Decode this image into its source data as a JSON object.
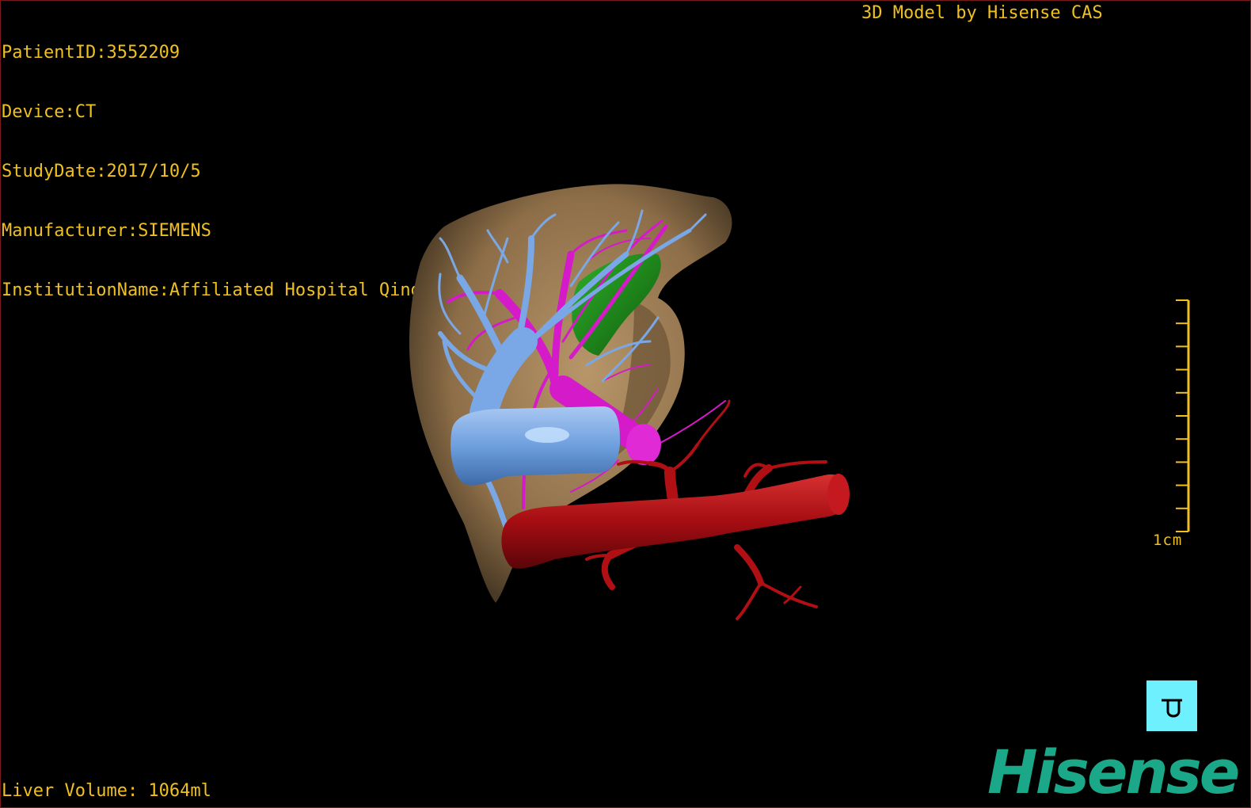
{
  "patient_info": {
    "patient_id": "PatientID:3552209",
    "device": "Device:CT",
    "study_date": "StudyDate:2017/10/5",
    "manufacturer": "Manufacturer:SIEMENS",
    "institution": "InstitutionName:Affiliated Hospital Qingdao University-C"
  },
  "credit": "3D Model by Hisense CAS",
  "liver_volume": "Liver Volume: 1064ml",
  "scale_bar": {
    "label": "1cm",
    "tick_count": 10
  },
  "orientation_button": {
    "icon": "orientation-cube-icon"
  },
  "brand": "Hisense",
  "colors": {
    "overlay_text": "#f0c020",
    "liver": "#a8865a",
    "portal_vein": "#6e9fde",
    "hepatic_artery": "#b00f14",
    "hepatic_vein": "#d51ac9",
    "gallbladder": "#1f8a1a",
    "brand": "#1aa888",
    "orientation_button": "#6ff0ff"
  }
}
